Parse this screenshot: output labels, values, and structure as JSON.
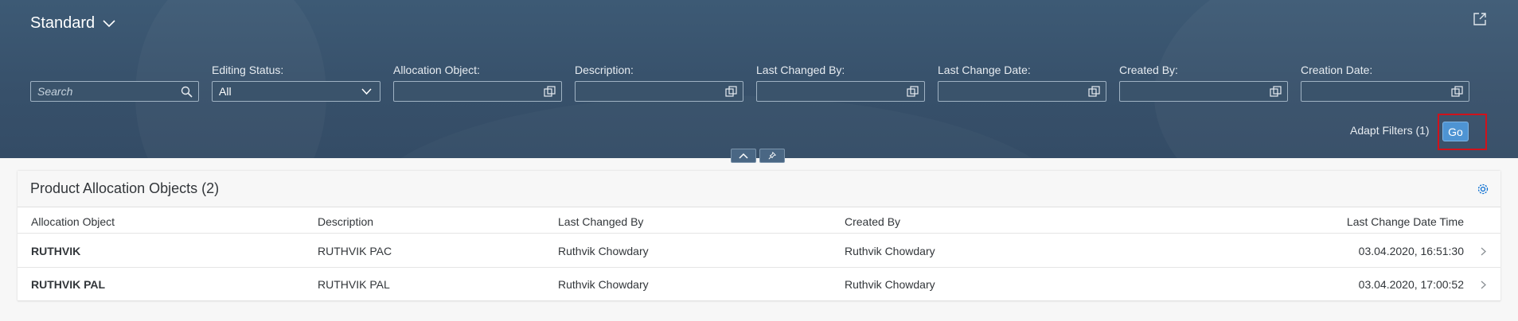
{
  "header": {
    "variant": "Standard",
    "filters": {
      "search_placeholder": "Search",
      "editing_status": {
        "label": "Editing Status:",
        "value": "All"
      },
      "allocation_object": {
        "label": "Allocation Object:"
      },
      "description": {
        "label": "Description:"
      },
      "last_changed_by": {
        "label": "Last Changed By:"
      },
      "last_change_date": {
        "label": "Last Change Date:"
      },
      "created_by": {
        "label": "Created By:"
      },
      "creation_date": {
        "label": "Creation Date:"
      }
    },
    "adapt_filters": "Adapt Filters (1)",
    "go": "Go"
  },
  "table": {
    "title": "Product Allocation Objects (2)",
    "columns": [
      "Allocation Object",
      "Description",
      "Last Changed By",
      "Created By",
      "Last Change Date Time"
    ],
    "rows": [
      {
        "allocation_object": "RUTHVIK",
        "description": "RUTHVIK PAC",
        "last_changed_by": "Ruthvik Chowdary",
        "created_by": "Ruthvik Chowdary",
        "last_change": "03.04.2020, 16:51:30"
      },
      {
        "allocation_object": "RUTHVIK PAL",
        "description": "RUTHVIK PAL",
        "last_changed_by": "Ruthvik Chowdary",
        "created_by": "Ruthvik Chowdary",
        "last_change": "03.04.2020, 17:00:52"
      }
    ]
  },
  "colors": {
    "header_bg": "#37506a",
    "go_button": "#4e94d3",
    "highlight": "#d0121b"
  },
  "icons": [
    "chevron-down-icon",
    "share-icon",
    "search-icon",
    "value-help-icon",
    "collapse-up-icon",
    "pin-icon",
    "settings-gear-icon",
    "chevron-right-icon"
  ]
}
